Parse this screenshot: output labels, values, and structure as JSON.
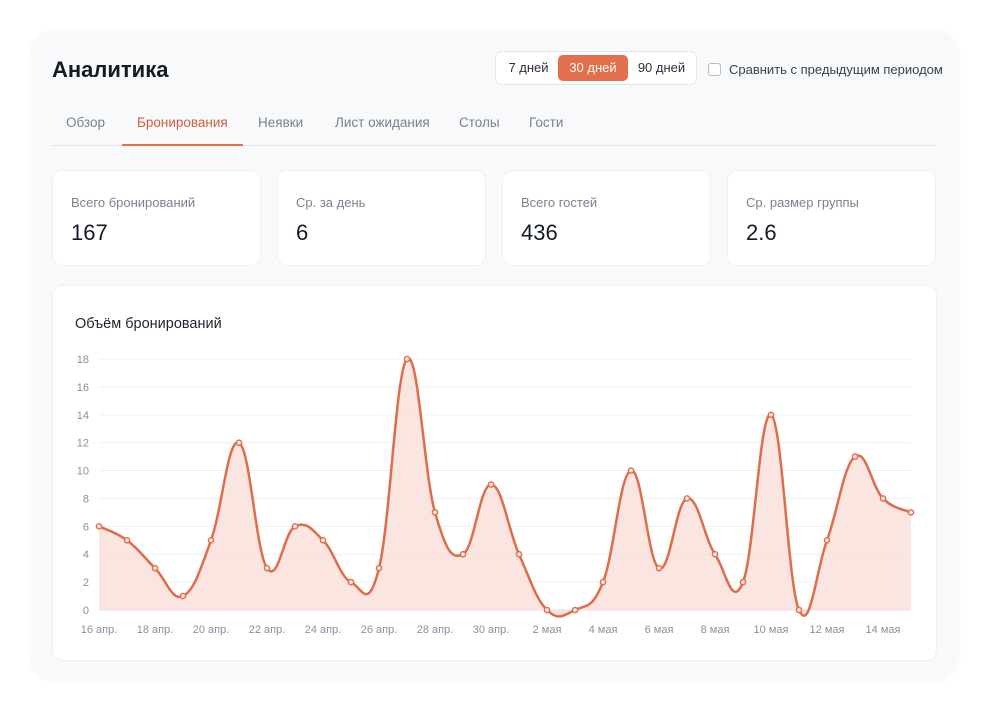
{
  "header": {
    "title": "Аналитика"
  },
  "period": {
    "options": [
      "7 дней",
      "30 дней",
      "90 дней"
    ],
    "selected": "30 дней",
    "accent_color": "#e46f4c"
  },
  "compare": {
    "label": "Сравнить с предыдущим периодом",
    "checked": false
  },
  "tabs": [
    {
      "label": "Обзор"
    },
    {
      "label": "Бронирования",
      "active": true
    },
    {
      "label": "Неявки"
    },
    {
      "label": "Лист ожидания"
    },
    {
      "label": "Столы"
    },
    {
      "label": "Гости"
    }
  ],
  "stats": [
    {
      "label": "Всего бронирований",
      "value": "167"
    },
    {
      "label": "Ср. за день",
      "value": "6"
    },
    {
      "label": "Всего гостей",
      "value": "436"
    },
    {
      "label": "Ср. размер группы",
      "value": "2.6"
    }
  ],
  "chart_title": "Объём бронирований",
  "chart_data": {
    "type": "area",
    "title": "Объём бронирований",
    "x": [
      "16 апр.",
      "17 апр.",
      "18 апр.",
      "19 апр.",
      "20 апр.",
      "21 апр.",
      "22 апр.",
      "23 апр.",
      "24 апр.",
      "25 апр.",
      "26 апр.",
      "27 апр.",
      "28 апр.",
      "29 апр.",
      "30 апр.",
      "1 мая",
      "2 мая",
      "3 мая",
      "4 мая",
      "5 мая",
      "6 мая",
      "7 мая",
      "8 мая",
      "9 мая",
      "10 мая",
      "11 мая",
      "12 мая",
      "13 мая",
      "14 мая",
      "15 мая"
    ],
    "x_tick_labels": [
      "16 апр.",
      "18 апр.",
      "20 апр.",
      "22 апр.",
      "24 апр.",
      "26 апр.",
      "28 апр.",
      "30 апр.",
      "2 мая",
      "4 мая",
      "6 мая",
      "8 мая",
      "10 мая",
      "12 мая",
      "14 мая"
    ],
    "values": [
      6,
      5,
      3,
      1,
      5,
      12,
      3,
      6,
      5,
      2,
      3,
      18,
      7,
      4,
      9,
      4,
      0,
      0,
      2,
      10,
      3,
      8,
      4,
      2,
      14,
      0,
      5,
      11,
      8,
      7
    ],
    "ylim": [
      0,
      18
    ],
    "y_ticks": [
      0,
      2,
      4,
      6,
      8,
      10,
      12,
      14,
      16,
      18
    ],
    "grid": true,
    "line_color": "#dd6d4b",
    "fill_color": "#f9e1da"
  }
}
